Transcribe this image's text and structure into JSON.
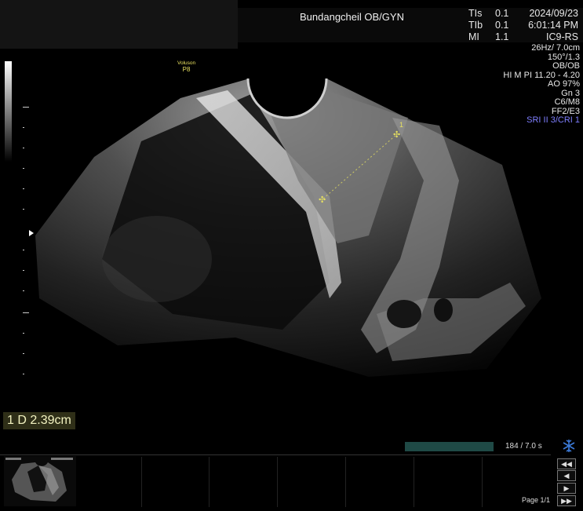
{
  "header": {
    "facility": "Bundangcheil OB/GYN",
    "indices": [
      {
        "label": "TIs",
        "value": "0.1"
      },
      {
        "label": "TIb",
        "value": "0.1"
      },
      {
        "label": "MI",
        "value": "1.1"
      }
    ],
    "date": "2024/09/23",
    "time": "6:01:14 PM",
    "probe": "IC9-RS"
  },
  "params": [
    "26Hz/ 7.0cm",
    "150°/1.3",
    "OB/OB",
    "HI M PI 11.20 - 4.20",
    "AO 97%",
    "Gn  3",
    "C6/M8",
    "FF2/E3",
    "SRI II 3/CRI 1"
  ],
  "logo": {
    "line1": "Voluson",
    "line2": "P8"
  },
  "caliper_label": "1",
  "measurement": "1 D 2.39cm",
  "cine": {
    "label": "184 / 7.0 s",
    "progress": 1.0
  },
  "footer": {
    "page": "Page 1/1"
  },
  "colors": {
    "caliper": "#e6e060",
    "cine_bar": "#1f4a46",
    "accent": "#3b7ad8",
    "sri": "#7f7fff"
  },
  "icons": [
    "freeze-icon",
    "rewind-icon",
    "step-back-icon",
    "play-icon",
    "fast-forward-icon"
  ]
}
